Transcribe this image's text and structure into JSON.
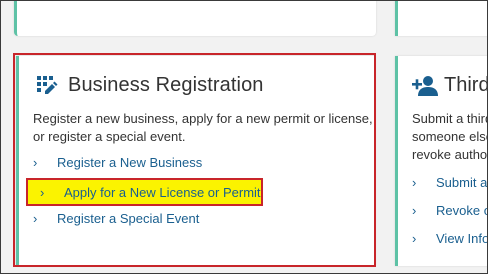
{
  "colors": {
    "accent_teal": "#5ec2a6",
    "link_blue": "#1a5f8f",
    "highlight_yellow": "#fbf300",
    "outline_red": "#c8252a"
  },
  "business_registration": {
    "icon": "grid-edit-icon",
    "title": "Business Registration",
    "description": "Register a new business, apply for a new permit or license, or register a special event.",
    "links": [
      {
        "label": "Register a New Business",
        "icon": "chevron-right-icon"
      },
      {
        "label": "Apply for a New License or Permit",
        "icon": "chevron-right-icon"
      },
      {
        "label": "Register a Special Event",
        "icon": "chevron-right-icon"
      }
    ]
  },
  "third_party": {
    "icon": "add-person-icon",
    "title": "Third",
    "description_lines": [
      "Submit a third",
      "someone else",
      "revoke author"
    ],
    "links": [
      {
        "label": "Submit a",
        "icon": "chevron-right-icon"
      },
      {
        "label": "Revoke o",
        "icon": "chevron-right-icon"
      },
      {
        "label": "View Info",
        "icon": "chevron-right-icon"
      }
    ]
  }
}
